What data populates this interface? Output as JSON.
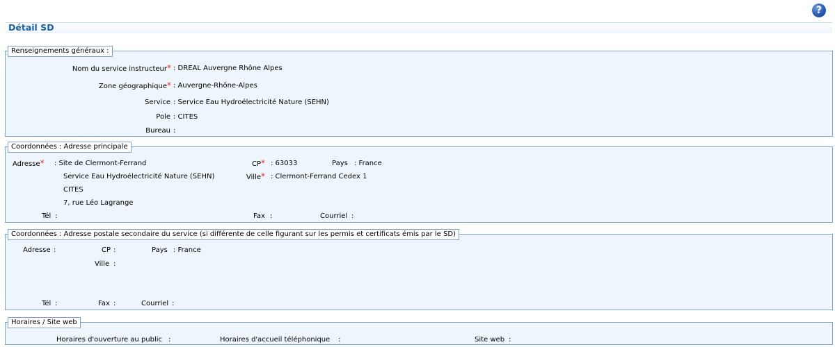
{
  "help": {
    "glyph": "?"
  },
  "title": "Détail SD",
  "general": {
    "legend": "Renseignements généraux :",
    "service_instructeur": {
      "label": "Nom du service instructeur",
      "value": ": DREAL Auvergne Rhône Alpes"
    },
    "zone": {
      "label": "Zone géographique",
      "value": ": Auvergne-Rhône-Alpes"
    },
    "service": {
      "label": "Service",
      "value": ": Service Eau Hydroélectricité Nature (SEHN)"
    },
    "pole": {
      "label": "Pole",
      "value": ": CITES"
    },
    "bureau": {
      "label": "Bureau",
      "value": ":"
    }
  },
  "main_address": {
    "legend": "Coordonnées : Adresse principale",
    "adresse_label": "Adresse",
    "adresse_lines": [
      ": Site de Clermont-Ferrand",
      "Service Eau Hydroélectricité Nature (SEHN)",
      "CITES",
      "7, rue Léo Lagrange"
    ],
    "cp": {
      "label": "CP",
      "value": ": 63033"
    },
    "pays": {
      "label": "Pays",
      "value": ": France"
    },
    "ville": {
      "label": "Ville",
      "value": ": Clermont-Ferrand Cedex 1"
    },
    "tel": {
      "label": "Tél",
      "value": ":"
    },
    "fax": {
      "label": "Fax",
      "value": ":"
    },
    "courriel": {
      "label": "Courriel",
      "value": ":"
    }
  },
  "secondary_address": {
    "legend": "Coordonnées : Adresse postale secondaire du service (si différente de celle figurant sur les permis et certificats émis par le SD)",
    "adresse": {
      "label": "Adresse",
      "value": ":"
    },
    "cp": {
      "label": "CP",
      "value": ":"
    },
    "pays": {
      "label": "Pays",
      "value": ": France"
    },
    "ville": {
      "label": "Ville",
      "value": ":"
    },
    "tel": {
      "label": "Tél",
      "value": ":"
    },
    "fax": {
      "label": "Fax",
      "value": ":"
    },
    "courriel": {
      "label": "Courriel",
      "value": ":"
    }
  },
  "hours": {
    "legend": "Horaires / Site web",
    "ouverture": {
      "label": "Horaires d'ouverture au public",
      "value": ":"
    },
    "accueil": {
      "label": "Horaires d'accueil téléphonique",
      "value": ":"
    },
    "site": {
      "label": "Site web",
      "value": ":"
    }
  },
  "colors": {
    "required": "#e8282b",
    "title": "#1b5fa5",
    "border": "#7fa4cc",
    "panel": "#eef5fc"
  }
}
